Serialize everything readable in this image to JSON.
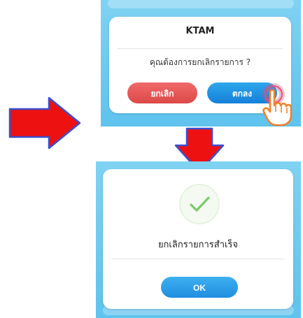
{
  "confirm_dialog": {
    "title": "KTAM",
    "message": "คุณต้องการยกเลิกรายการ ?",
    "cancel_label": "ยกเลิก",
    "ok_label": "ตกลง"
  },
  "success_dialog": {
    "message": "ยกเลิกรายการสำเร็จ",
    "ok_label": "OK"
  },
  "colors": {
    "panel_blue": "#5fc3ee",
    "cancel_red": "#dc4848",
    "ok_blue": "#1580d9",
    "arrow_red": "#ee1111",
    "arrow_outline": "#3a4fd0",
    "check_green": "#7cc96a",
    "hand_orange": "#f0822a"
  },
  "icons": {
    "arrow_right": "arrow-right-icon",
    "arrow_down": "arrow-down-icon",
    "checkmark": "check-icon",
    "tap_hand": "pointing-hand-icon"
  }
}
